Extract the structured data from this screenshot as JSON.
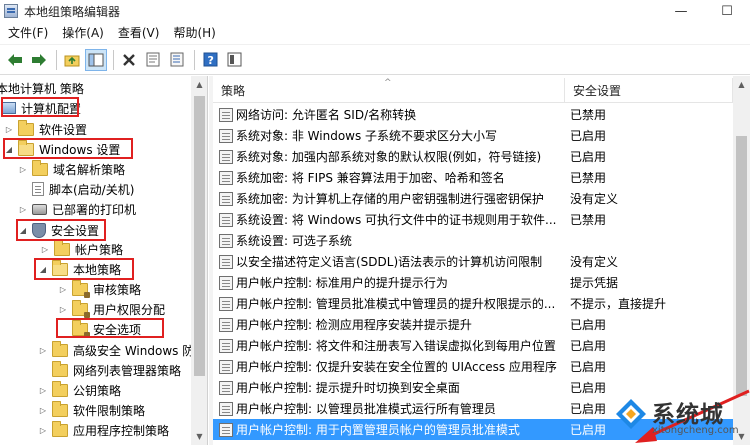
{
  "window": {
    "title": "本地组策略编辑器",
    "minimize": "—",
    "maximize": "☐"
  },
  "menu": [
    "文件(F)",
    "操作(A)",
    "查看(V)",
    "帮助(H)"
  ],
  "tree": {
    "header": "本地计算机 策略",
    "items": [
      {
        "label": "计算机配置",
        "expander": "",
        "icon": "computer-icon"
      },
      {
        "label": "软件设置",
        "expander": "▷",
        "icon": "folder-icon"
      },
      {
        "label": "Windows 设置",
        "expander": "◢",
        "icon": "folder-open-icon"
      },
      {
        "label": "域名解析策略",
        "expander": "▷",
        "icon": "folder-icon"
      },
      {
        "label": "脚本(启动/关机)",
        "expander": "",
        "icon": "script-icon"
      },
      {
        "label": "已部署的打印机",
        "expander": "▷",
        "icon": "printer-icon"
      },
      {
        "label": "安全设置",
        "expander": "◢",
        "icon": "shield-icon"
      },
      {
        "label": "帐户策略",
        "expander": "▷",
        "icon": "folder-icon"
      },
      {
        "label": "本地策略",
        "expander": "◢",
        "icon": "folder-open-icon"
      },
      {
        "label": "审核策略",
        "expander": "▷",
        "icon": "folder-lock-icon"
      },
      {
        "label": "用户权限分配",
        "expander": "▷",
        "icon": "folder-lock-icon"
      },
      {
        "label": "安全选项",
        "expander": "",
        "icon": "folder-lock-icon"
      },
      {
        "label": "高级安全 Windows 防",
        "expander": "▷",
        "icon": "folder-icon"
      },
      {
        "label": "网络列表管理器策略",
        "expander": "",
        "icon": "folder-icon"
      },
      {
        "label": "公钥策略",
        "expander": "▷",
        "icon": "folder-icon"
      },
      {
        "label": "软件限制策略",
        "expander": "▷",
        "icon": "folder-icon"
      },
      {
        "label": "应用程序控制策略",
        "expander": "▷",
        "icon": "folder-icon"
      }
    ]
  },
  "list": {
    "col_policy": "策略",
    "col_setting": "安全设置",
    "rows": [
      {
        "name": "网络访问: 允许匿名 SID/名称转换",
        "setting": "已禁用"
      },
      {
        "name": "系统对象: 非 Windows 子系统不要求区分大小写",
        "setting": "已启用"
      },
      {
        "name": "系统对象: 加强内部系统对象的默认权限(例如，符号链接)",
        "setting": "已启用"
      },
      {
        "name": "系统加密: 将 FIPS 兼容算法用于加密、哈希和签名",
        "setting": "已禁用"
      },
      {
        "name": "系统加密: 为计算机上存储的用户密钥强制进行强密钥保护",
        "setting": "没有定义"
      },
      {
        "name": "系统设置: 将 Windows 可执行文件中的证书规则用于软件...",
        "setting": "已禁用"
      },
      {
        "name": "系统设置: 可选子系统",
        "setting": ""
      },
      {
        "name": "以安全描述符定义语言(SDDL)语法表示的计算机访问限制",
        "setting": "没有定义"
      },
      {
        "name": "用户帐户控制: 标准用户的提升提示行为",
        "setting": "提示凭据"
      },
      {
        "name": "用户帐户控制: 管理员批准模式中管理员的提升权限提示的...",
        "setting": "不提示，直接提升"
      },
      {
        "name": "用户帐户控制: 检测应用程序安装并提示提升",
        "setting": "已启用"
      },
      {
        "name": "用户帐户控制: 将文件和注册表写入错误虚拟化到每用户位置",
        "setting": "已启用"
      },
      {
        "name": "用户帐户控制: 仅提升安装在安全位置的 UIAccess 应用程序",
        "setting": "已启用"
      },
      {
        "name": "用户帐户控制: 提示提升时切换到安全桌面",
        "setting": "已启用"
      },
      {
        "name": "用户帐户控制: 以管理员批准模式运行所有管理员",
        "setting": "已启用"
      },
      {
        "name": "用户帐户控制: 用于内置管理员帐户的管理员批准模式",
        "setting": "已启用"
      }
    ]
  },
  "watermark": {
    "brand": "系统城",
    "url": "xitongcheng.com"
  },
  "colors": {
    "highlight": "#e02020",
    "selection": "#3399ff"
  }
}
